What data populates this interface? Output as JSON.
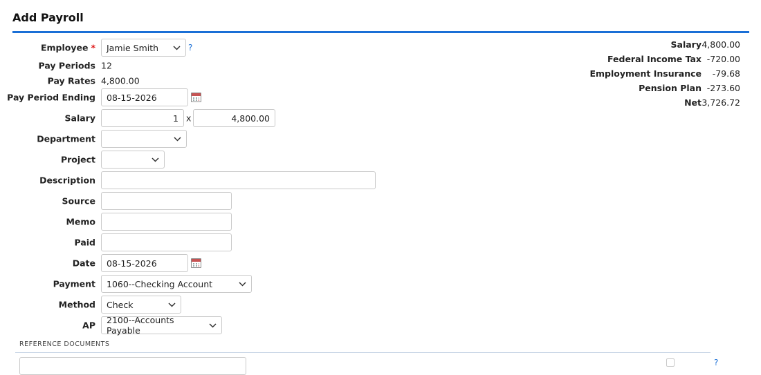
{
  "page": {
    "title": "Add Payroll"
  },
  "form": {
    "employee": {
      "label": "Employee",
      "required_mark": "*",
      "value": "Jamie Smith",
      "help": "?"
    },
    "pay_periods": {
      "label": "Pay Periods",
      "value": "12"
    },
    "pay_rates": {
      "label": "Pay Rates",
      "value": "4,800.00"
    },
    "pay_period_ending": {
      "label": "Pay Period Ending",
      "value": "08-15-2026"
    },
    "salary": {
      "label": "Salary",
      "qty": "1",
      "times": "x",
      "amount": "4,800.00"
    },
    "department": {
      "label": "Department",
      "value": ""
    },
    "project": {
      "label": "Project",
      "value": ""
    },
    "description": {
      "label": "Description",
      "value": ""
    },
    "source": {
      "label": "Source",
      "value": ""
    },
    "memo": {
      "label": "Memo",
      "value": ""
    },
    "paid": {
      "label": "Paid",
      "value": ""
    },
    "date": {
      "label": "Date",
      "value": "08-15-2026"
    },
    "payment": {
      "label": "Payment",
      "value": "1060--Checking Account"
    },
    "method": {
      "label": "Method",
      "value": "Check"
    },
    "ap": {
      "label": "AP",
      "value": "2100--Accounts Payable"
    }
  },
  "summary": {
    "items": [
      {
        "label": "Salary",
        "value": "4,800.00"
      },
      {
        "label": "Federal Income Tax",
        "value": "-720.00"
      },
      {
        "label": "Employment Insurance",
        "value": "-79.68"
      },
      {
        "label": "Pension Plan",
        "value": "-273.60"
      },
      {
        "label": "Net",
        "value": "3,726.72"
      }
    ]
  },
  "reference_documents": {
    "heading": "REFERENCE DOCUMENTS",
    "help": "?"
  },
  "icons": {
    "dropdown": "chevron-down-icon",
    "calendar": "calendar-icon"
  },
  "colors": {
    "accent": "#1a6fd6",
    "required": "#dd1111"
  }
}
